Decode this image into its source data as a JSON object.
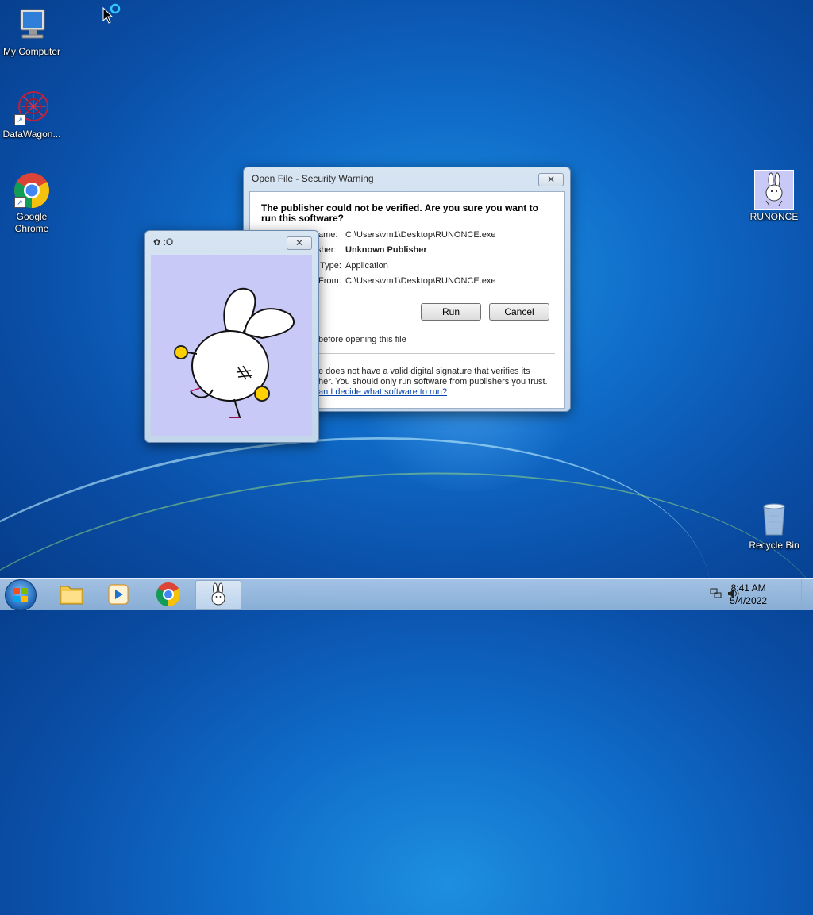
{
  "desktop": {
    "icons": [
      {
        "label": "My Computer"
      },
      {
        "label": "DataWagon..."
      },
      {
        "label": "Google Chrome"
      },
      {
        "label": "RUNONCE"
      },
      {
        "label": "Recycle Bin"
      }
    ]
  },
  "security_dialog": {
    "title": "Open File - Security Warning",
    "heading": "The publisher could not be verified.  Are you sure you want to run this software?",
    "fields": [
      {
        "label": "ame:",
        "value": "C:\\Users\\vm1\\Desktop\\RUNONCE.exe"
      },
      {
        "label": "sher:",
        "value": "Unknown Publisher"
      },
      {
        "label": "Type:",
        "value": "Application"
      },
      {
        "label": "From:",
        "value": "C:\\Users\\vm1\\Desktop\\RUNONCE.exe"
      }
    ],
    "run_label": "Run",
    "cancel_label": "Cancel",
    "checkbox_text": "before opening this file",
    "warning_line1": "e does not have a valid digital signature that verifies its",
    "warning_line2": "her.  You should only run software from publishers you trust.",
    "help_link": "an I decide what software to run?",
    "close_glyph": "✕"
  },
  "bunny_window": {
    "title": ":O",
    "close_glyph": "✕"
  },
  "taskbar": {
    "time": "8:41 AM",
    "date": "5/4/2022"
  }
}
